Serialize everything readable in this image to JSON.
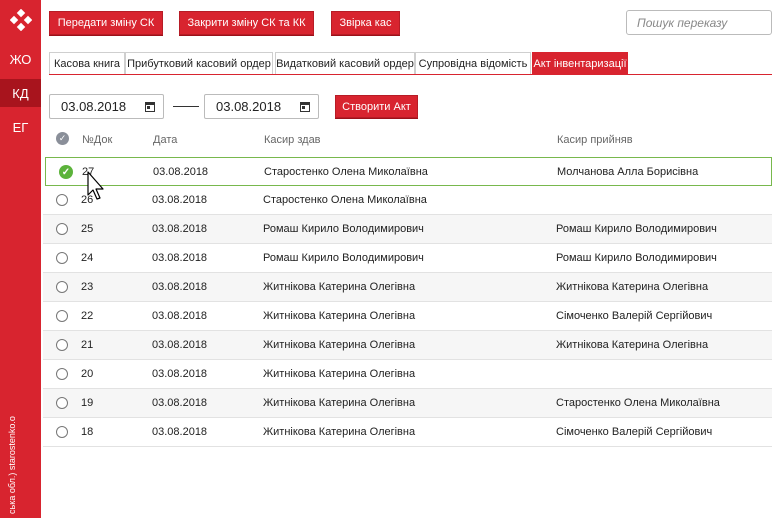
{
  "sidebar": {
    "items": [
      {
        "label": "ЖО",
        "active": false
      },
      {
        "label": "КД",
        "active": true
      },
      {
        "label": "ЕГ",
        "active": false
      }
    ],
    "footer_text": "ська обл.) starostenko.o"
  },
  "toolbar": {
    "transfer_shift": "Передати зміну СК",
    "close_shift": "Закрити зміну СК та КК",
    "reconcile": "Звірка кас"
  },
  "search": {
    "placeholder": "Пошук переказу",
    "value": ""
  },
  "tabs": [
    {
      "label": "Касова книга"
    },
    {
      "label": "Прибутковий касовий ордер"
    },
    {
      "label": "Видатковий касовий ордер"
    },
    {
      "label": "Супровідна відомість"
    },
    {
      "label": "Акт інвентаризації",
      "active": true
    }
  ],
  "filter": {
    "date_from": "03.08.2018",
    "date_to": "03.08.2018",
    "create_button": "Створити Акт"
  },
  "table": {
    "columns": [
      "№Док",
      "Дата",
      "Касир здав",
      "Касир прийняв"
    ],
    "rows": [
      {
        "num": "27",
        "date": "03.08.2018",
        "gave": "Старостенко Олена Миколаївна",
        "received": "Молчанова Алла Борисівна",
        "selected": true
      },
      {
        "num": "26",
        "date": "03.08.2018",
        "gave": "Старостенко Олена Миколаївна",
        "received": ""
      },
      {
        "num": "25",
        "date": "03.08.2018",
        "gave": "Ромаш Кирило Володимирович",
        "received": "Ромаш Кирило Володимирович"
      },
      {
        "num": "24",
        "date": "03.08.2018",
        "gave": "Ромаш Кирило Володимирович",
        "received": "Ромаш Кирило Володимирович"
      },
      {
        "num": "23",
        "date": "03.08.2018",
        "gave": "Житнікова Катерина Олегівна",
        "received": "Житнікова Катерина Олегівна"
      },
      {
        "num": "22",
        "date": "03.08.2018",
        "gave": "Житнікова Катерина Олегівна",
        "received": "Сімоченко Валерій Сергійович"
      },
      {
        "num": "21",
        "date": "03.08.2018",
        "gave": "Житнікова Катерина Олегівна",
        "received": "Житнікова Катерина Олегівна"
      },
      {
        "num": "20",
        "date": "03.08.2018",
        "gave": "Житнікова Катерина Олегівна",
        "received": ""
      },
      {
        "num": "19",
        "date": "03.08.2018",
        "gave": "Житнікова Катерина Олегівна",
        "received": "Старостенко Олена Миколаївна"
      },
      {
        "num": "18",
        "date": "03.08.2018",
        "gave": "Житнікова Катерина Олегівна",
        "received": "Сімоченко Валерій Сергійович"
      }
    ]
  },
  "colors": {
    "brand": "#d8242f",
    "selected_border": "#78b84d"
  },
  "icons": [
    "logo-icon",
    "calendar-icon",
    "check-icon",
    "radio-icon",
    "mouse-cursor-icon"
  ]
}
